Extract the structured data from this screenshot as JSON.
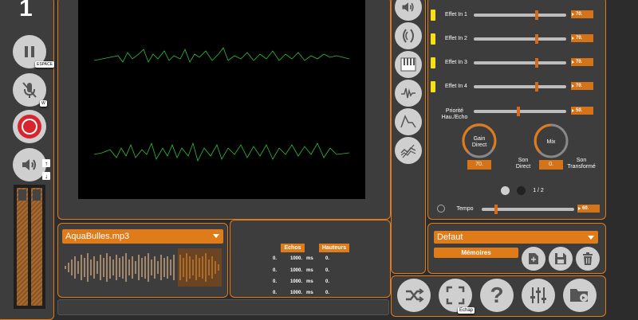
{
  "track_number": "1",
  "left": {
    "pause_hint": "ESPACE",
    "mic_hint": "W",
    "up_arrow": "↑",
    "down_arrow": "↓"
  },
  "player": {
    "file": "AquaBulles.mp3"
  },
  "table": {
    "echos_header": "Echos",
    "heights_header": "Hauteurs",
    "rows": [
      {
        "num": "0.",
        "val": "1000.",
        "unit": "ms",
        "h": "0."
      },
      {
        "num": "0.",
        "val": "1000.",
        "unit": "ms",
        "h": "0."
      },
      {
        "num": "0.",
        "val": "1000.",
        "unit": "ms",
        "h": "0."
      },
      {
        "num": "0.",
        "val": "1000.",
        "unit": "ms",
        "h": "0."
      }
    ]
  },
  "effects": {
    "rows": [
      {
        "label": "Effet In 1",
        "value": "70.",
        "level": 70
      },
      {
        "label": "Effet In 2",
        "value": "70.",
        "level": 70
      },
      {
        "label": "Effet In 3",
        "value": "70.",
        "level": 70
      },
      {
        "label": "Effet In 4",
        "value": "70.",
        "level": 70
      }
    ],
    "priority_label": "Priorité Hau./Echo",
    "priority_value": "50.",
    "priority_level": 50,
    "gain_label": "Gain Direct",
    "gain_value": "70.",
    "mix_label": "Mix",
    "mix_value": "0.",
    "son_direct": "Son Direct",
    "son_transforme": "Son Transformé",
    "page": "1 / 2",
    "tempo_label": "Tempo",
    "tempo_value": "60.",
    "tempo_level": 10
  },
  "memory": {
    "preset": "Defaut",
    "memoires_label": "Mémoires"
  },
  "bottom": {
    "fullscreen_hint": "Echap"
  },
  "colors": {
    "accent": "#e07b1a",
    "panel": "#3d3d3d",
    "wave": "#2fbf3a",
    "indicator": "#f5e015"
  }
}
